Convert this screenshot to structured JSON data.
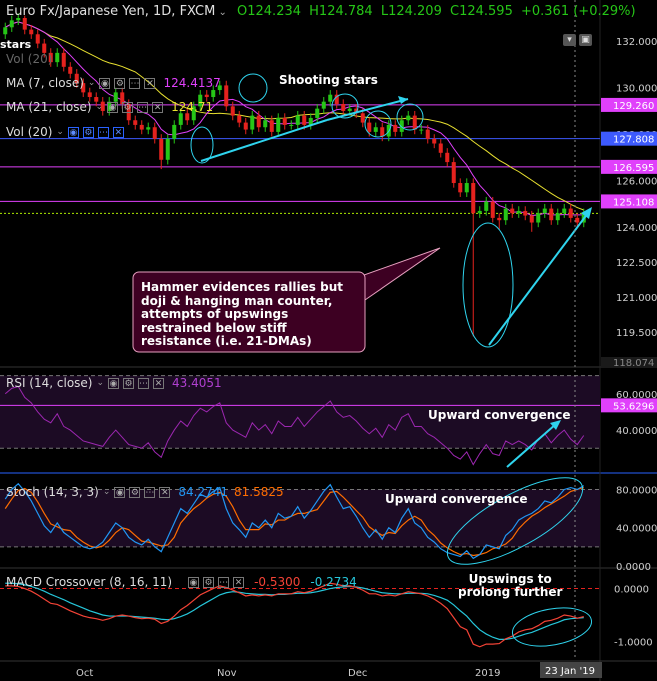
{
  "header": {
    "symbol": "Euro Fx/Japanese Yen, 1D, FXCM",
    "open": "O124.234",
    "high": "H124.784",
    "low": "L124.209",
    "close": "C124.595",
    "change": "+0.361 (+0.29%)"
  },
  "overlay_labels": {
    "stars": "stars",
    "vol_faded": "Vol (20)"
  },
  "indicators": {
    "ma7": {
      "label": "MA (7, close)",
      "value": "124.4137",
      "color": "#e040fb"
    },
    "ma21": {
      "label": "MA (21, close)",
      "value": "124.71",
      "color": "#e8e030"
    },
    "vol": {
      "label": "Vol (20)"
    },
    "rsi": {
      "label": "RSI (14, close)",
      "value": "43.4051",
      "color": "#9c27b0"
    },
    "stoch": {
      "label": "Stoch (14, 3, 3)",
      "k_value": "84.2741",
      "d_value": "81.5825",
      "k_color": "#2196f3",
      "d_color": "#ff6d00"
    },
    "macd": {
      "label": "MACD Crossover (8, 16, 11)",
      "macd_value": "-0.5300",
      "signal_value": "-0.2734",
      "macd_color": "#f44336",
      "signal_color": "#26c6da"
    }
  },
  "annotations": {
    "shooting_stars": "Shooting stars",
    "rsi_note": "Upward convergence",
    "stoch_note": "Upward convergence",
    "macd_note_1": "Upswings to",
    "macd_note_2": "prolong further",
    "callout_lines": [
      "Hammer evidences rallies but",
      "doji & hanging man counter,",
      "attempts of upswings",
      "restrained below stiff",
      "resistance (i.e. 21-DMAs)"
    ]
  },
  "price_scale": {
    "ticks": [
      "132.000",
      "130.000",
      "128.000",
      "126.000",
      "124.000",
      "122.500",
      "121.000",
      "119.500"
    ],
    "levels": [
      {
        "label": "129.260",
        "value": 129.26,
        "color": "#e040fb",
        "style": "solid"
      },
      {
        "label": "127.808",
        "value": 127.808,
        "color": "#3d5afe",
        "style": "solid"
      },
      {
        "label": "126.595",
        "value": 126.595,
        "color": "#e040fb",
        "style": "solid"
      },
      {
        "label": "125.108",
        "value": 125.108,
        "color": "#e040fb",
        "style": "solid"
      },
      {
        "label": "124.595",
        "value": 124.595,
        "color": "#aeea00",
        "style": "dotted"
      }
    ],
    "bottom_label": "118.074"
  },
  "rsi_scale": {
    "ticks": [
      "60.0000",
      "40.0000"
    ],
    "badge": "53.6296",
    "badge_color": "#e040fb"
  },
  "stoch_scale": {
    "ticks": [
      "80.0000",
      "40.0000",
      "0.0000"
    ]
  },
  "macd_scale": {
    "ticks": [
      "0.0000",
      "-1.0000"
    ]
  },
  "time_axis": {
    "labels": [
      "Oct",
      "Nov",
      "Dec",
      "2019"
    ],
    "cursor_label": "23 Jan '19"
  },
  "colors": {
    "bull": "#26c617",
    "bear": "#e5221e",
    "annotation_cyan": "#2fd4ee",
    "background": "#000000"
  },
  "chart_data": {
    "type": "candlestick",
    "title": "Euro Fx/Japanese Yen, 1D, FXCM",
    "x_range": [
      "2018-09-24",
      "2019-01-25"
    ],
    "ylim": [
      118.07,
      133
    ],
    "dates": [
      "2018-09-24",
      "2018-09-25",
      "2018-09-26",
      "2018-09-27",
      "2018-09-28",
      "2018-10-01",
      "2018-10-02",
      "2018-10-03",
      "2018-10-04",
      "2018-10-05",
      "2018-10-08",
      "2018-10-09",
      "2018-10-10",
      "2018-10-11",
      "2018-10-12",
      "2018-10-15",
      "2018-10-16",
      "2018-10-17",
      "2018-10-18",
      "2018-10-19",
      "2018-10-22",
      "2018-10-23",
      "2018-10-24",
      "2018-10-25",
      "2018-10-26",
      "2018-10-29",
      "2018-10-30",
      "2018-10-31",
      "2018-11-01",
      "2018-11-02",
      "2018-11-05",
      "2018-11-06",
      "2018-11-07",
      "2018-11-08",
      "2018-11-09",
      "2018-11-12",
      "2018-11-13",
      "2018-11-14",
      "2018-11-15",
      "2018-11-16",
      "2018-11-19",
      "2018-11-20",
      "2018-11-21",
      "2018-11-22",
      "2018-11-23",
      "2018-11-26",
      "2018-11-27",
      "2018-11-28",
      "2018-11-29",
      "2018-11-30",
      "2018-12-03",
      "2018-12-04",
      "2018-12-05",
      "2018-12-06",
      "2018-12-07",
      "2018-12-10",
      "2018-12-11",
      "2018-12-12",
      "2018-12-13",
      "2018-12-14",
      "2018-12-17",
      "2018-12-18",
      "2018-12-19",
      "2018-12-20",
      "2018-12-21",
      "2018-12-24",
      "2018-12-25",
      "2018-12-26",
      "2018-12-27",
      "2018-12-28",
      "2018-12-31",
      "2019-01-01",
      "2019-01-02",
      "2019-01-03",
      "2019-01-04",
      "2019-01-07",
      "2019-01-08",
      "2019-01-09",
      "2019-01-10",
      "2019-01-11",
      "2019-01-14",
      "2019-01-15",
      "2019-01-16",
      "2019-01-17",
      "2019-01-18",
      "2019-01-21",
      "2019-01-22",
      "2019-01-23",
      "2019-01-24",
      "2019-01-25"
    ],
    "open": [
      132.3,
      132.6,
      132.9,
      133.0,
      132.5,
      132.3,
      131.9,
      131.5,
      131.1,
      131.5,
      130.9,
      130.6,
      130.2,
      129.8,
      129.6,
      129.4,
      129.0,
      129.4,
      129.8,
      129.3,
      128.6,
      128.4,
      128.2,
      128.3,
      127.8,
      126.9,
      127.8,
      128.4,
      128.9,
      128.6,
      129.2,
      129.7,
      129.6,
      129.9,
      130.1,
      129.2,
      128.8,
      128.5,
      128.2,
      128.8,
      128.3,
      128.6,
      128.1,
      128.7,
      128.4,
      128.4,
      128.8,
      128.4,
      128.7,
      129.1,
      129.4,
      129.7,
      129.3,
      129.0,
      129.1,
      128.9,
      128.5,
      128.1,
      128.3,
      127.9,
      128.4,
      128.1,
      128.6,
      128.8,
      128.2,
      128.2,
      127.8,
      127.6,
      127.2,
      126.8,
      125.9,
      125.5,
      125.9,
      124.6,
      124.7,
      125.1,
      124.4,
      124.3,
      124.8,
      124.6,
      124.7,
      124.5,
      124.2,
      124.6,
      124.8,
      124.3,
      124.6,
      124.8,
      124.4,
      124.2
    ],
    "close": [
      132.6,
      132.9,
      133.0,
      132.5,
      132.3,
      131.9,
      131.5,
      131.1,
      131.5,
      130.9,
      130.6,
      130.2,
      129.8,
      129.6,
      129.4,
      129.0,
      129.4,
      129.8,
      129.3,
      128.6,
      128.4,
      128.2,
      128.3,
      127.8,
      126.9,
      127.8,
      128.4,
      128.9,
      128.6,
      129.2,
      129.7,
      129.6,
      129.9,
      130.1,
      129.2,
      128.8,
      128.5,
      128.2,
      128.8,
      128.3,
      128.6,
      128.1,
      128.7,
      128.4,
      128.4,
      128.8,
      128.4,
      128.7,
      129.1,
      129.4,
      129.7,
      129.3,
      129.0,
      129.1,
      128.9,
      128.5,
      128.1,
      128.3,
      127.9,
      128.4,
      128.1,
      128.6,
      128.8,
      128.2,
      128.2,
      127.8,
      127.6,
      127.2,
      126.8,
      125.9,
      125.5,
      125.9,
      124.6,
      124.7,
      125.1,
      124.4,
      124.3,
      124.8,
      124.6,
      124.7,
      124.5,
      124.2,
      124.6,
      124.8,
      124.3,
      124.6,
      124.8,
      124.4,
      124.2,
      124.6
    ],
    "high": [
      132.8,
      133.1,
      133.2,
      133.1,
      132.7,
      132.5,
      132.1,
      131.7,
      131.7,
      131.7,
      131.1,
      130.8,
      130.4,
      130.0,
      129.8,
      129.6,
      129.6,
      130.0,
      130.0,
      129.5,
      128.8,
      128.6,
      128.5,
      128.5,
      128.0,
      128.0,
      128.6,
      129.1,
      129.1,
      129.4,
      129.9,
      129.9,
      130.1,
      130.3,
      130.3,
      129.4,
      129.0,
      128.7,
      129.0,
      129.0,
      128.8,
      128.8,
      128.9,
      128.9,
      128.6,
      129.0,
      129.0,
      128.9,
      129.3,
      129.6,
      129.9,
      129.9,
      129.5,
      129.3,
      129.3,
      129.1,
      128.7,
      128.5,
      128.5,
      128.6,
      128.6,
      128.8,
      129.0,
      129.0,
      128.4,
      128.4,
      128.0,
      127.8,
      127.4,
      127.0,
      126.1,
      126.1,
      126.1,
      124.9,
      125.3,
      125.3,
      124.6,
      125.0,
      125.0,
      124.9,
      124.9,
      124.7,
      124.8,
      125.0,
      125.0,
      124.8,
      125.0,
      125.0,
      124.6,
      124.8
    ],
    "low": [
      132.1,
      132.4,
      132.7,
      132.3,
      132.1,
      131.7,
      131.3,
      130.9,
      130.9,
      130.7,
      130.4,
      130.0,
      129.6,
      129.4,
      129.2,
      128.8,
      128.8,
      129.2,
      129.1,
      128.4,
      128.2,
      128.0,
      128.0,
      127.6,
      126.5,
      126.7,
      127.6,
      128.2,
      128.4,
      128.4,
      129.0,
      129.4,
      129.4,
      129.7,
      129.0,
      128.6,
      128.3,
      128.0,
      128.0,
      128.1,
      128.1,
      127.9,
      127.9,
      128.2,
      128.2,
      128.2,
      128.2,
      128.2,
      128.5,
      128.9,
      129.2,
      129.1,
      128.8,
      128.8,
      128.7,
      128.3,
      127.9,
      127.9,
      127.7,
      127.7,
      127.9,
      127.9,
      128.4,
      128.0,
      128.0,
      127.6,
      127.4,
      127.0,
      126.6,
      125.7,
      125.3,
      125.3,
      119.3,
      124.4,
      124.5,
      124.2,
      123.9,
      124.1,
      124.4,
      124.4,
      124.3,
      123.8,
      124.0,
      124.4,
      124.1,
      124.1,
      124.4,
      124.2,
      124.0,
      124.0
    ],
    "rsi_ylim": [
      18,
      72
    ],
    "rsi": [
      60,
      63,
      64,
      58,
      55,
      50,
      46,
      44,
      49,
      42,
      40,
      37,
      34,
      33,
      32,
      31,
      36,
      40,
      36,
      32,
      31,
      30,
      33,
      28,
      25,
      34,
      40,
      45,
      42,
      48,
      52,
      50,
      53,
      55,
      44,
      40,
      38,
      36,
      44,
      40,
      43,
      38,
      45,
      42,
      42,
      47,
      42,
      46,
      50,
      53,
      56,
      50,
      47,
      48,
      45,
      41,
      38,
      41,
      36,
      43,
      40,
      47,
      49,
      42,
      42,
      38,
      36,
      33,
      30,
      26,
      24,
      28,
      21,
      27,
      32,
      27,
      26,
      34,
      32,
      34,
      32,
      29,
      35,
      38,
      33,
      37,
      40,
      35,
      32,
      37
    ],
    "stoch_ylim": [
      0,
      92
    ],
    "stoch_k": [
      70,
      80,
      86,
      78,
      68,
      55,
      42,
      35,
      45,
      35,
      30,
      25,
      20,
      18,
      20,
      25,
      35,
      45,
      40,
      30,
      25,
      22,
      28,
      20,
      15,
      30,
      45,
      60,
      55,
      65,
      75,
      72,
      78,
      82,
      60,
      45,
      38,
      30,
      45,
      40,
      48,
      40,
      55,
      50,
      52,
      62,
      50,
      58,
      68,
      78,
      85,
      72,
      60,
      62,
      52,
      40,
      30,
      38,
      28,
      40,
      35,
      50,
      60,
      45,
      40,
      30,
      25,
      18,
      14,
      12,
      10,
      16,
      8,
      12,
      22,
      20,
      18,
      32,
      38,
      48,
      52,
      55,
      60,
      68,
      66,
      72,
      80,
      82,
      80,
      84
    ],
    "stoch_d": [
      60,
      70,
      79,
      81,
      77,
      67,
      55,
      44,
      41,
      38,
      37,
      30,
      25,
      21,
      19,
      21,
      27,
      35,
      40,
      38,
      32,
      26,
      25,
      23,
      21,
      22,
      30,
      45,
      53,
      60,
      65,
      71,
      75,
      77,
      73,
      62,
      48,
      38,
      38,
      38,
      44,
      43,
      48,
      48,
      52,
      55,
      55,
      57,
      59,
      68,
      77,
      78,
      72,
      65,
      58,
      51,
      41,
      36,
      32,
      35,
      34,
      42,
      48,
      52,
      48,
      38,
      32,
      24,
      19,
      15,
      12,
      13,
      11,
      12,
      14,
      18,
      20,
      23,
      29,
      39,
      46,
      52,
      56,
      61,
      65,
      69,
      73,
      78,
      80,
      82
    ],
    "macd_ylim": [
      -1.35,
      0.35
    ],
    "macd": [
      0.05,
      0.05,
      0.04,
      0.0,
      -0.05,
      -0.12,
      -0.2,
      -0.28,
      -0.3,
      -0.36,
      -0.42,
      -0.47,
      -0.52,
      -0.55,
      -0.57,
      -0.6,
      -0.57,
      -0.52,
      -0.5,
      -0.52,
      -0.55,
      -0.57,
      -0.56,
      -0.58,
      -0.66,
      -0.62,
      -0.52,
      -0.4,
      -0.32,
      -0.22,
      -0.12,
      -0.06,
      0.0,
      0.05,
      0.02,
      -0.03,
      -0.08,
      -0.14,
      -0.12,
      -0.14,
      -0.12,
      -0.14,
      -0.1,
      -0.1,
      -0.1,
      -0.06,
      -0.08,
      -0.05,
      0.0,
      0.05,
      0.1,
      0.08,
      0.05,
      0.05,
      0.02,
      -0.03,
      -0.1,
      -0.1,
      -0.14,
      -0.12,
      -0.14,
      -0.1,
      -0.06,
      -0.08,
      -0.1,
      -0.14,
      -0.2,
      -0.28,
      -0.38,
      -0.55,
      -0.72,
      -0.78,
      -1.05,
      -1.1,
      -1.05,
      -1.05,
      -1.04,
      -0.95,
      -0.9,
      -0.82,
      -0.78,
      -0.76,
      -0.7,
      -0.62,
      -0.6,
      -0.56,
      -0.5,
      -0.52,
      -0.56,
      -0.53
    ],
    "macd_signal": [
      0.1,
      0.1,
      0.09,
      0.07,
      0.04,
      0.0,
      -0.05,
      -0.11,
      -0.16,
      -0.21,
      -0.27,
      -0.32,
      -0.37,
      -0.42,
      -0.46,
      -0.5,
      -0.52,
      -0.52,
      -0.52,
      -0.52,
      -0.53,
      -0.54,
      -0.55,
      -0.56,
      -0.58,
      -0.59,
      -0.57,
      -0.53,
      -0.48,
      -0.41,
      -0.33,
      -0.26,
      -0.19,
      -0.12,
      -0.08,
      -0.06,
      -0.07,
      -0.09,
      -0.1,
      -0.11,
      -0.11,
      -0.12,
      -0.11,
      -0.11,
      -0.1,
      -0.09,
      -0.09,
      -0.08,
      -0.06,
      -0.03,
      0.0,
      0.02,
      0.03,
      0.04,
      0.03,
      0.01,
      -0.02,
      -0.05,
      -0.08,
      -0.09,
      -0.1,
      -0.1,
      -0.09,
      -0.09,
      -0.09,
      -0.1,
      -0.13,
      -0.17,
      -0.22,
      -0.31,
      -0.42,
      -0.52,
      -0.66,
      -0.78,
      -0.86,
      -0.92,
      -0.96,
      -0.96,
      -0.94,
      -0.9,
      -0.86,
      -0.83,
      -0.78,
      -0.73,
      -0.68,
      -0.64,
      -0.59,
      -0.57,
      -0.56,
      -0.55
    ]
  }
}
